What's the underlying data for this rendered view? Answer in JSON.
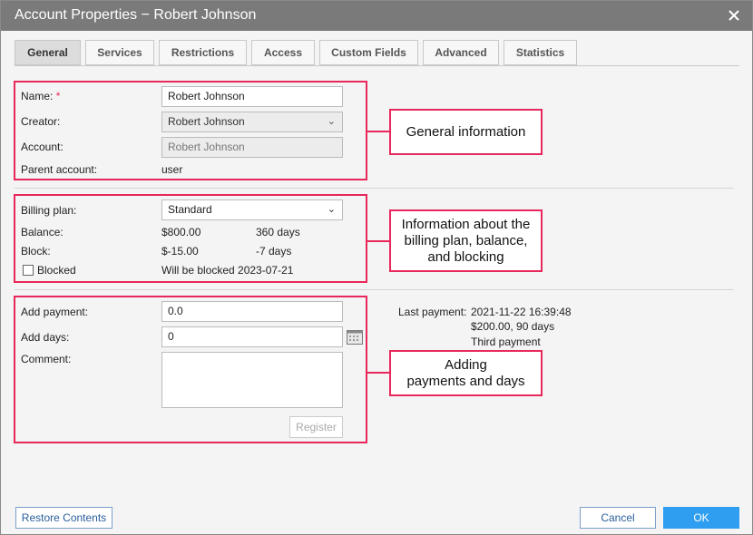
{
  "window": {
    "title": "Account Properties − Robert Johnson",
    "close_icon": "close-icon"
  },
  "tabs": [
    {
      "label": "General",
      "active": true
    },
    {
      "label": "Services",
      "active": false
    },
    {
      "label": "Restrictions",
      "active": false
    },
    {
      "label": "Access",
      "active": false
    },
    {
      "label": "Custom Fields",
      "active": false
    },
    {
      "label": "Advanced",
      "active": false
    },
    {
      "label": "Statistics",
      "active": false
    }
  ],
  "general": {
    "name_label": "Name:",
    "required_mark": "*",
    "name_value": "Robert Johnson",
    "creator_label": "Creator:",
    "creator_value": "Robert Johnson",
    "account_label": "Account:",
    "account_value": "Robert Johnson",
    "parent_label": "Parent account:",
    "parent_value": "user",
    "callout": "General information"
  },
  "billing": {
    "plan_label": "Billing plan:",
    "plan_value": "Standard",
    "balance_label": "Balance:",
    "balance_value": "$800.00",
    "balance_days": "360 days",
    "block_label": "Block:",
    "block_value": "$-15.00",
    "block_days": "-7 days",
    "blocked_label": "Blocked",
    "blocked_checked": false,
    "blocked_note": "Will be blocked 2023-07-21",
    "callout_line1": "Information about the",
    "callout_line2": "billing plan, balance,",
    "callout_line3": "and blocking"
  },
  "payment": {
    "add_payment_label": "Add payment:",
    "add_payment_value": "0.0",
    "add_days_label": "Add days:",
    "add_days_value": "0",
    "comment_label": "Comment:",
    "register_label": "Register",
    "last_payment_label": "Last payment:",
    "last_payment_date": "2021-11-22 16:39:48",
    "last_payment_amount": "$200.00, 90 days",
    "last_payment_comment": "Third payment",
    "callout_line1": "Adding",
    "callout_line2": "payments and days"
  },
  "footer": {
    "restore_label": "Restore Contents",
    "cancel_label": "Cancel",
    "ok_label": "OK"
  },
  "colors": {
    "highlight": "#e8275a",
    "titlebar": "#7a7a7a",
    "ok_button": "#2f9ef0"
  }
}
